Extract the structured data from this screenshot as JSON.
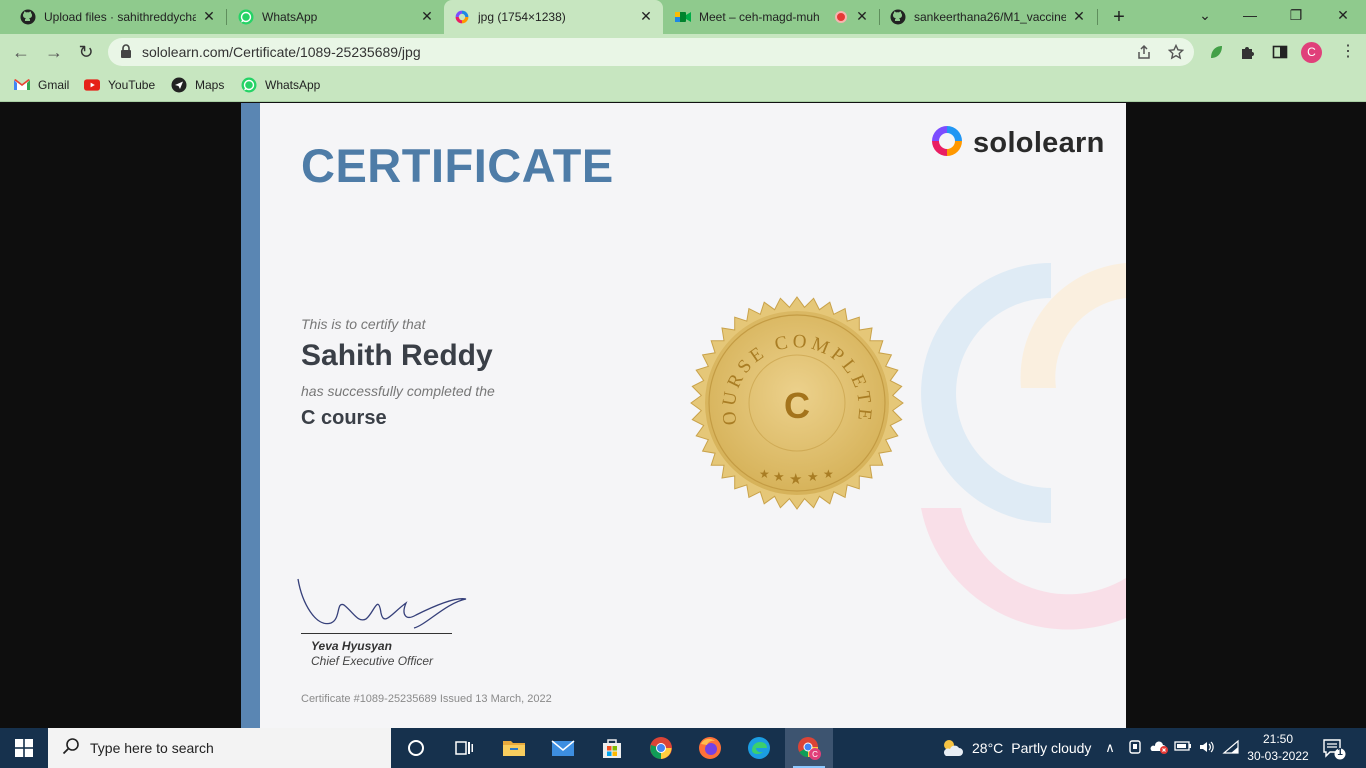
{
  "browser": {
    "tabs": [
      {
        "title": "Upload files · sahithreddycha",
        "icon": "github-icon"
      },
      {
        "title": "WhatsApp",
        "icon": "whatsapp-icon"
      },
      {
        "title": "jpg (1754×1238)",
        "icon": "sololearn-icon",
        "active": true
      },
      {
        "title": "Meet – ceh-magd-muh",
        "icon": "google-meet-icon",
        "recording": true
      },
      {
        "title": "sankeerthana26/M1_vaccine_",
        "icon": "github-icon"
      }
    ],
    "url": "sololearn.com/Certificate/1089-25235689/jpg",
    "bookmarks": [
      {
        "label": "Gmail",
        "icon": "gmail-icon"
      },
      {
        "label": "YouTube",
        "icon": "youtube-icon"
      },
      {
        "label": "Maps",
        "icon": "maps-icon"
      },
      {
        "label": "WhatsApp",
        "icon": "whatsapp-icon"
      }
    ],
    "profile_initial": "C"
  },
  "certificate": {
    "title": "CERTIFICATE",
    "brand": "sololearn",
    "certify_line": "This is to certify that",
    "recipient": "Sahith Reddy",
    "completed_line": "has successfully completed the",
    "course": "C course",
    "seal_text": "COURSE COMPLETED",
    "seal_letter": "C",
    "signer_name": "Yeva Hyusyan",
    "signer_title": "Chief Executive Officer",
    "certificate_number": "Certificate #1089-25235689 Issued 13 March, 2022"
  },
  "taskbar": {
    "search_placeholder": "Type here to search",
    "weather_temp": "28°C",
    "weather_desc": "Partly cloudy",
    "time": "21:50",
    "date": "30-03-2022",
    "notification_count": "1"
  },
  "colors": {
    "tab_bar": "#8fca8d",
    "toolbar": "#c7e6c0",
    "cert_title": "#4e7ca7",
    "cert_stripe": "#5a86b3",
    "seal_gold": "#d9b65e",
    "taskbar": "#16314d"
  }
}
